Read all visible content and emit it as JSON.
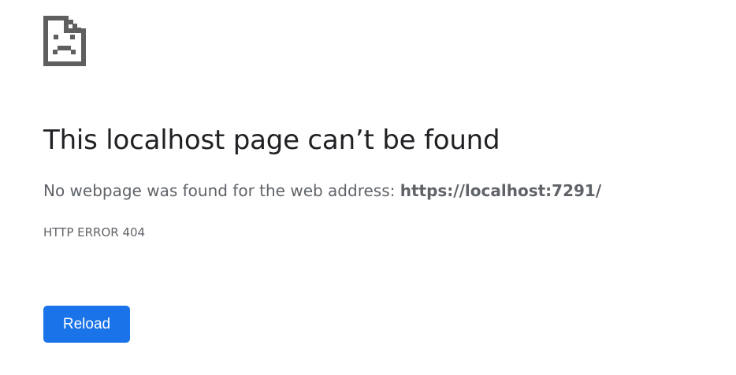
{
  "error_page": {
    "icon": "sad-document-icon",
    "title": "This localhost page can’t be found",
    "message_prefix": "No webpage was found for the web address: ",
    "url": "https://localhost:7291/",
    "error_code": "HTTP ERROR 404",
    "reload_label": "Reload",
    "colors": {
      "button_background": "#1a73e8",
      "button_text": "#ffffff",
      "title_text": "#202124",
      "body_text": "#5f6368",
      "icon": "#5f5f5f"
    }
  }
}
